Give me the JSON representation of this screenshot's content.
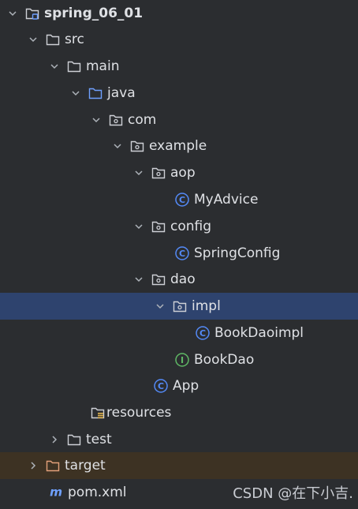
{
  "tree": [
    {
      "label": "spring_06_01",
      "icon": "module-folder-icon",
      "chevron": "down",
      "bold": true
    },
    {
      "label": "src",
      "icon": "folder-icon",
      "chevron": "down"
    },
    {
      "label": "main",
      "icon": "folder-icon",
      "chevron": "down"
    },
    {
      "label": "java",
      "icon": "source-root-folder-icon",
      "chevron": "down"
    },
    {
      "label": "com",
      "icon": "package-icon",
      "chevron": "down"
    },
    {
      "label": "example",
      "icon": "package-icon",
      "chevron": "down"
    },
    {
      "label": "aop",
      "icon": "package-icon",
      "chevron": "down"
    },
    {
      "label": "MyAdvice",
      "icon": "class-icon",
      "chevron": "none"
    },
    {
      "label": "config",
      "icon": "package-icon",
      "chevron": "down"
    },
    {
      "label": "SpringConfig",
      "icon": "class-icon",
      "chevron": "none"
    },
    {
      "label": "dao",
      "icon": "package-icon",
      "chevron": "down"
    },
    {
      "label": "impl",
      "icon": "package-icon",
      "chevron": "down",
      "selected": true
    },
    {
      "label": "BookDaoimpl",
      "icon": "class-icon",
      "chevron": "none"
    },
    {
      "label": "BookDao",
      "icon": "interface-icon",
      "chevron": "none"
    },
    {
      "label": "App",
      "icon": "class-icon",
      "chevron": "none"
    },
    {
      "label": "resources",
      "icon": "resources-folder-icon",
      "chevron": "none"
    },
    {
      "label": "test",
      "icon": "folder-icon",
      "chevron": "right"
    },
    {
      "label": "target",
      "icon": "excluded-folder-icon",
      "chevron": "right",
      "excluded": true
    },
    {
      "label": "pom.xml",
      "icon": "maven-icon",
      "chevron": "none"
    }
  ],
  "watermark": "CSDN @在下小吉.",
  "colors": {
    "background": "#2b2d30",
    "selected_row": "#2e436e",
    "excluded_row": "#3d3223",
    "class_icon": "#548af7",
    "interface_icon": "#5fb865",
    "excluded_folder": "#e3a07a",
    "source_root": "#6fa0ff",
    "text": "#dfe1e5"
  }
}
